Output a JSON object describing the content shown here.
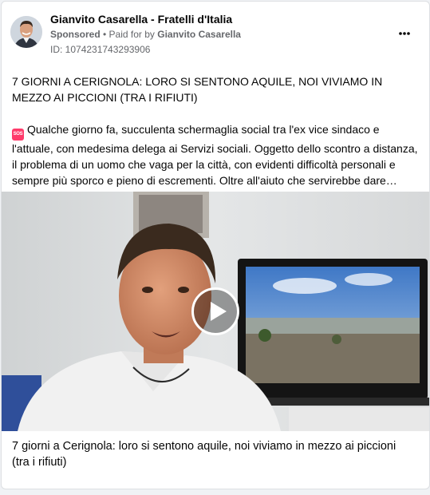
{
  "post": {
    "page_name": "Gianvito Casarella - Fratelli d'Italia",
    "sponsored_label": "Sponsored",
    "separator": " • ",
    "paid_for_prefix": "Paid for by ",
    "paid_for_name": "Gianvito Casarella",
    "ad_id": "ID: 1074231743293906",
    "headline": "7 GIORNI A CERIGNOLA: LORO SI SENTONO AQUILE, NOI VIVIAMO IN MEZZO AI PICCIONI (TRA I RIFIUTI)",
    "body": "Qualche giorno fa, succulenta schermaglia social tra l'ex vice sindaco e l'attuale, con medesima delega ai Servizi sociali. Oggetto dello scontro a distanza, il problema di un uomo che vaga per la città, con evidenti difficoltà personali e sempre più sporco e pieno di escrementi. Oltre all'aiuto che servirebbe dare…",
    "sos_icon_text": "SOS",
    "video_caption": "7 giorni a Cerignola: loro si sentono aquile, noi viviamo in mezzo ai piccioni (tra i rifiuti)"
  },
  "icons": {
    "more": "more-horizontal-icon",
    "sos": "sos-icon",
    "play": "play-icon"
  },
  "colors": {
    "text_primary": "#050505",
    "text_secondary": "#65676b",
    "sos_badge": "#ff3b6b",
    "card_border": "#dddfe2"
  }
}
